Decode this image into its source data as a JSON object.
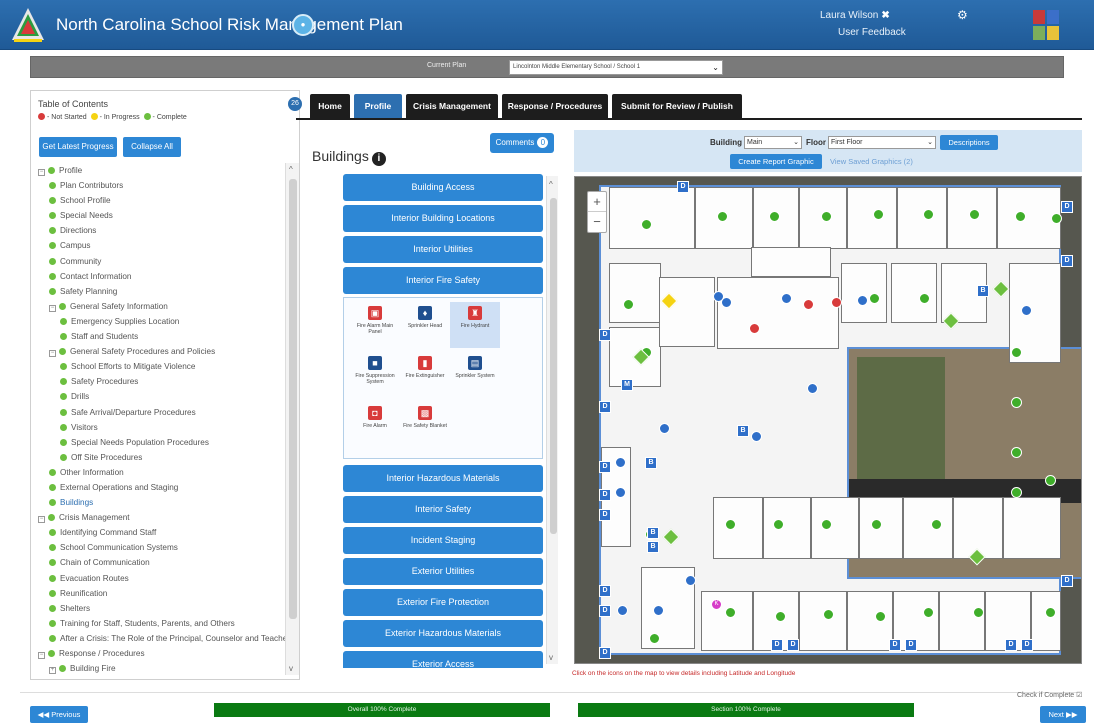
{
  "header": {
    "title": "North Carolina School Risk Management Plan",
    "user_name": "Laura Wilson",
    "user_close": "✖",
    "user_feedback": "User Feedback",
    "gear_icon": "gear-icon",
    "color_primary": "#2d6fb0"
  },
  "plan_bar": {
    "label": "Current Plan",
    "selected": "Lincolnton Middle Elementary School / School 1"
  },
  "sidebar": {
    "toc_title": "Table of Contents",
    "legend": {
      "not_started": "- Not Started",
      "in_progress": "- In Progress",
      "complete": "- Complete"
    },
    "collapse_badge": "26",
    "btn_progress": "Get Latest Progress",
    "btn_collapse": "Collapse All",
    "items": [
      {
        "label": "Profile",
        "box": "−"
      },
      {
        "label": "Plan Contributors"
      },
      {
        "label": "School Profile"
      },
      {
        "label": "Special Needs"
      },
      {
        "label": "Directions"
      },
      {
        "label": "Campus"
      },
      {
        "label": "Community"
      },
      {
        "label": "Contact Information"
      },
      {
        "label": "Safety Planning"
      },
      {
        "label": "General Safety Information",
        "box": "−"
      },
      {
        "label": "Emergency Supplies Location"
      },
      {
        "label": "Staff and Students"
      },
      {
        "label": "General Safety Procedures and Policies",
        "box": "−"
      },
      {
        "label": "School Efforts to Mitigate Violence"
      },
      {
        "label": "Safety Procedures"
      },
      {
        "label": "Drills"
      },
      {
        "label": "Safe Arrival/Departure Procedures"
      },
      {
        "label": "Visitors"
      },
      {
        "label": "Special Needs Population Procedures"
      },
      {
        "label": "Off Site Procedures"
      },
      {
        "label": "Other Information"
      },
      {
        "label": "External Operations and Staging"
      },
      {
        "label": "Buildings"
      },
      {
        "label": "Crisis Management",
        "box": "−"
      },
      {
        "label": "Identifying Command Staff"
      },
      {
        "label": "School Communication Systems"
      },
      {
        "label": "Chain of Communication"
      },
      {
        "label": "Evacuation Routes"
      },
      {
        "label": "Reunification"
      },
      {
        "label": "Shelters"
      },
      {
        "label": "Training for Staff, Students, Parents, and Others"
      },
      {
        "label": "After a Crisis: The Role of the Principal, Counselor and Teachers"
      },
      {
        "label": "Response / Procedures",
        "box": "−"
      },
      {
        "label": "Building Fire",
        "box": "+"
      }
    ]
  },
  "tabs": [
    {
      "label": "Home"
    },
    {
      "label": "Profile"
    },
    {
      "label": "Crisis Management"
    },
    {
      "label": "Response / Procedures"
    },
    {
      "label": "Submit for Review / Publish"
    }
  ],
  "buildings": {
    "title": "Buildings",
    "comments_label": "Comments",
    "comments_count": "0",
    "accordion": [
      "Building Access",
      "Interior Building Locations",
      "Interior Utilities",
      "Interior Fire Safety",
      "Interior Hazardous Materials",
      "Interior Safety",
      "Incident Staging",
      "Exterior Utilities",
      "Exterior Fire Protection",
      "Exterior Hazardous Materials",
      "Exterior Access"
    ],
    "fire_icons": [
      {
        "label": "Fire Alarm Main Panel",
        "color": "#d83b3b",
        "glyph": "▣"
      },
      {
        "label": "Sprinkler Head",
        "color": "#1f4f8f",
        "glyph": "♦"
      },
      {
        "label": "Fire Hydrant",
        "color": "#d83b3b",
        "glyph": "♜"
      },
      {
        "label": "Fire Suppression System",
        "color": "#1f4f8f",
        "glyph": "■"
      },
      {
        "label": "Fire Extinguisher",
        "color": "#d83b3b",
        "glyph": "▮"
      },
      {
        "label": "Sprinkler System",
        "color": "#1f4f8f",
        "glyph": "▤"
      },
      {
        "label": "Fire Alarm",
        "color": "#d83b3b",
        "glyph": "◘"
      },
      {
        "label": "Fire Safety Blanket",
        "color": "#d83b3b",
        "glyph": "▩"
      }
    ]
  },
  "map": {
    "building_label": "Building",
    "building_value": "Main",
    "floor_label": "Floor",
    "floor_value": "First Floor",
    "descriptions_btn": "Descriptions",
    "create_report_btn": "Create Report Graphic",
    "view_saved": "View Saved Graphics (2)",
    "caption": "Click on the icons on the map to view details including Latitude and Longitude",
    "zoom_in": "+",
    "zoom_out": "−",
    "d_label": "D",
    "m_label": "M",
    "b_label": "B",
    "k_label": "K"
  },
  "footer": {
    "previous": "◀◀ Previous",
    "next": "Next ▶▶",
    "overall": "Overall 100% Complete",
    "section": "Section 100% Complete",
    "overall_percent": 100,
    "section_percent": 100,
    "check_label": "Check if Complete ☑"
  }
}
